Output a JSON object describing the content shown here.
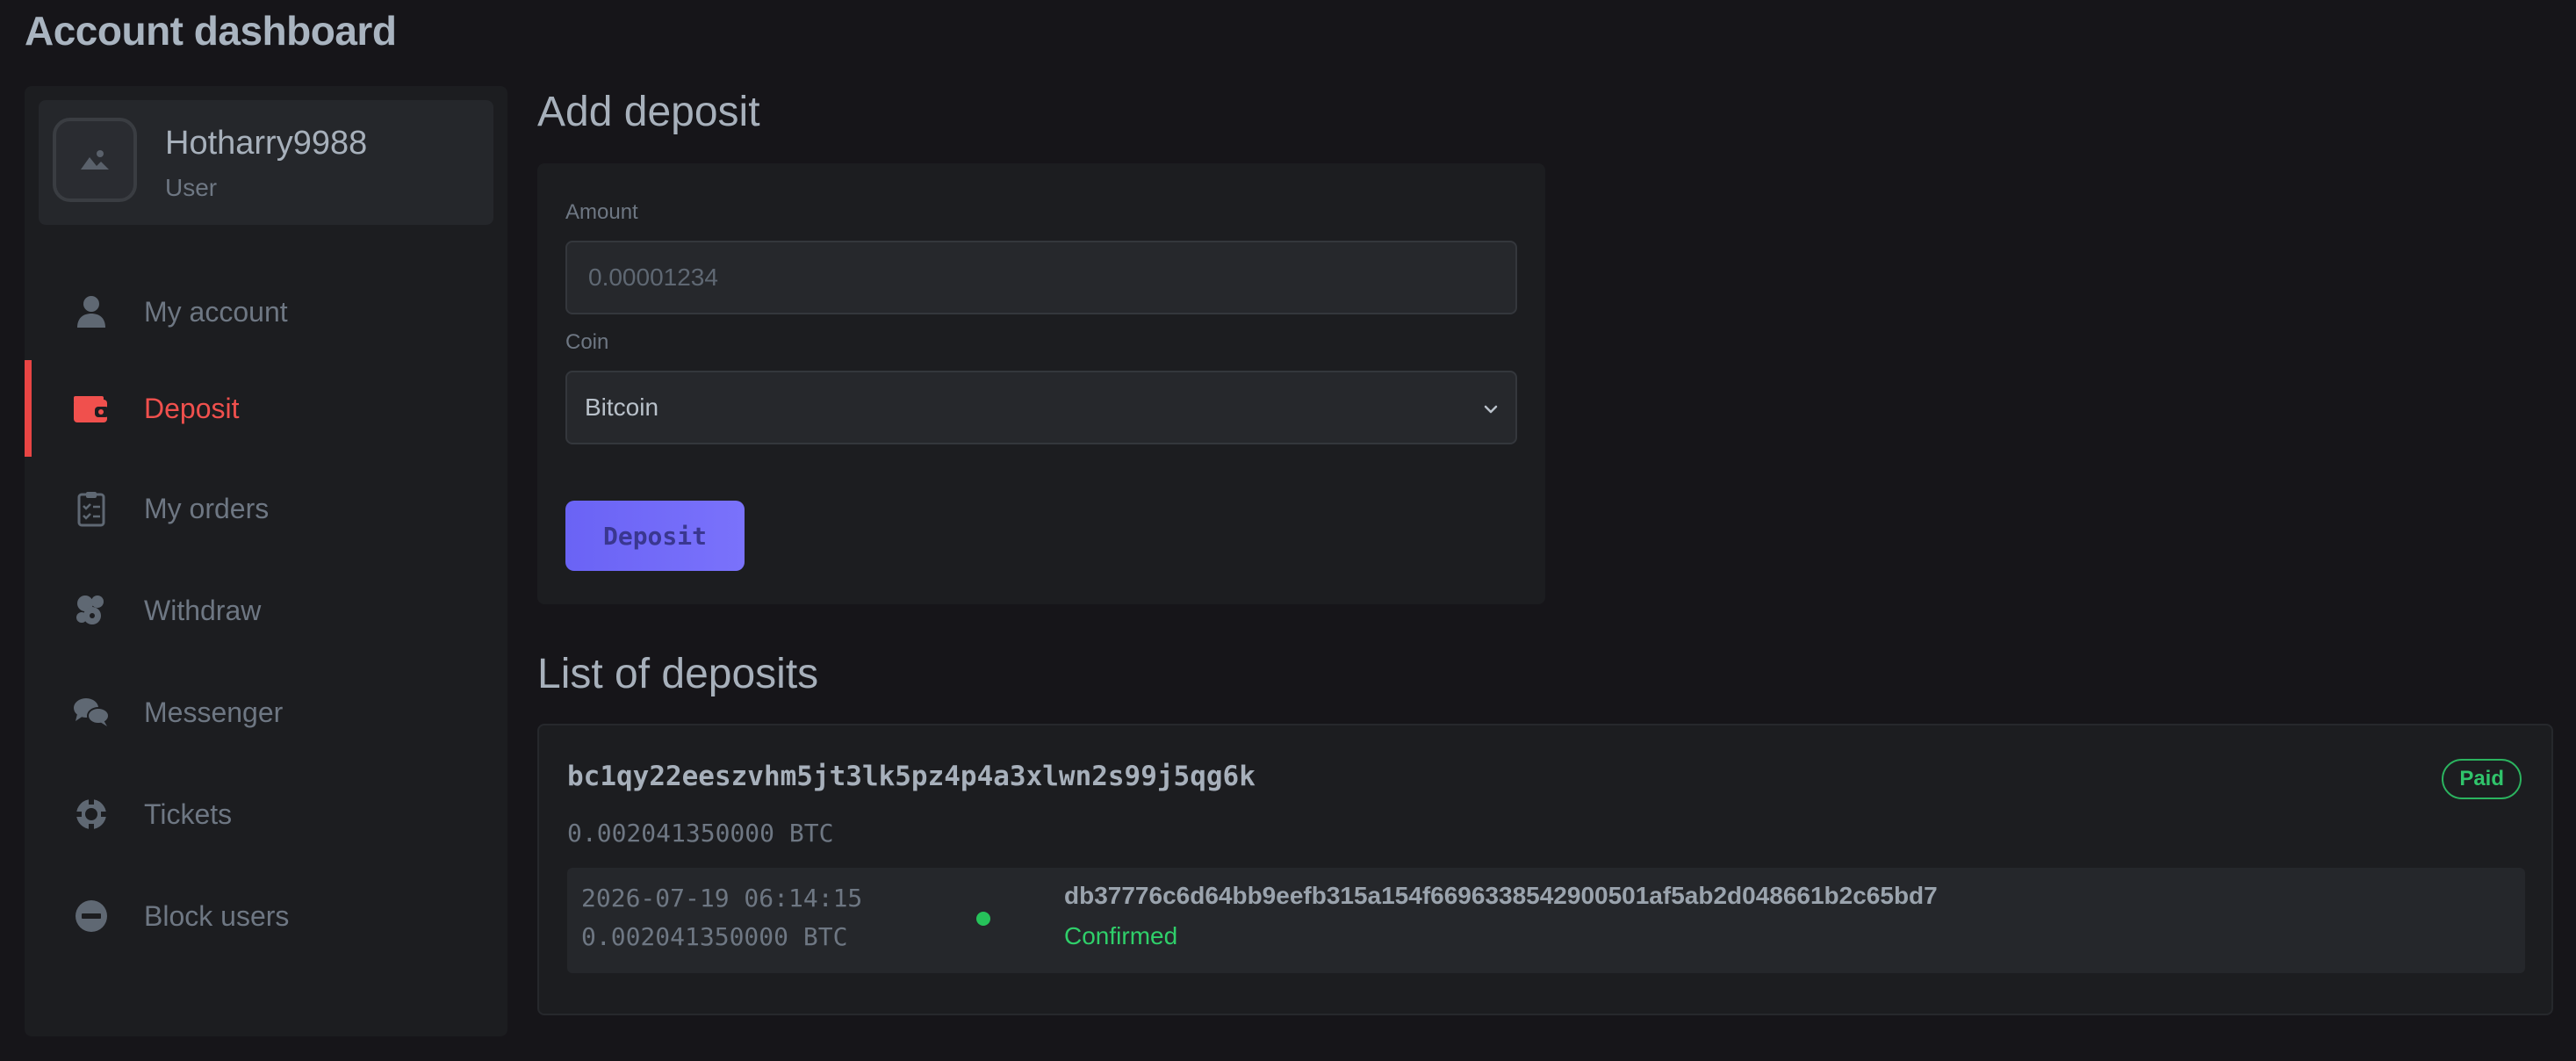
{
  "page": {
    "title": "Account dashboard"
  },
  "user": {
    "name": "Hotharry9988",
    "role": "User"
  },
  "sidebar": {
    "items": [
      {
        "label": "My account",
        "icon": "user-icon",
        "active": false
      },
      {
        "label": "Deposit",
        "icon": "wallet-icon",
        "active": true
      },
      {
        "label": "My orders",
        "icon": "clipboard-list-icon",
        "active": false
      },
      {
        "label": "Withdraw",
        "icon": "money-send-icon",
        "active": false
      },
      {
        "label": "Messenger",
        "icon": "chat-bubbles-icon",
        "active": false
      },
      {
        "label": "Tickets",
        "icon": "lifebuoy-icon",
        "active": false
      },
      {
        "label": "Block users",
        "icon": "block-icon",
        "active": false
      }
    ]
  },
  "deposit_form": {
    "title": "Add deposit",
    "amount_label": "Amount",
    "amount_value": "",
    "amount_placeholder": "0.00001234",
    "coin_label": "Coin",
    "coin_selected": "Bitcoin",
    "submit_label": "Deposit"
  },
  "deposits": {
    "title": "List of deposits",
    "items": [
      {
        "address": "bc1qy22eeszvhm5jt3lk5pz4p4a3xlwn2s99j5qg6k",
        "amount": "0.002041350000 BTC",
        "status": "Paid",
        "transaction": {
          "date": "2026-07-19 06:14:15",
          "amount": "0.002041350000 BTC",
          "hash": "db37776c6d64bb9eefb315a154f6696338542900501af5ab2d048661b2c65bd7",
          "status": "Confirmed"
        }
      }
    ]
  },
  "colors": {
    "background": "#161519",
    "panel": "#1c1d20",
    "accent_red": "#e84544",
    "button_purple": "#6a63f5",
    "success_green": "#2fcf6a"
  }
}
